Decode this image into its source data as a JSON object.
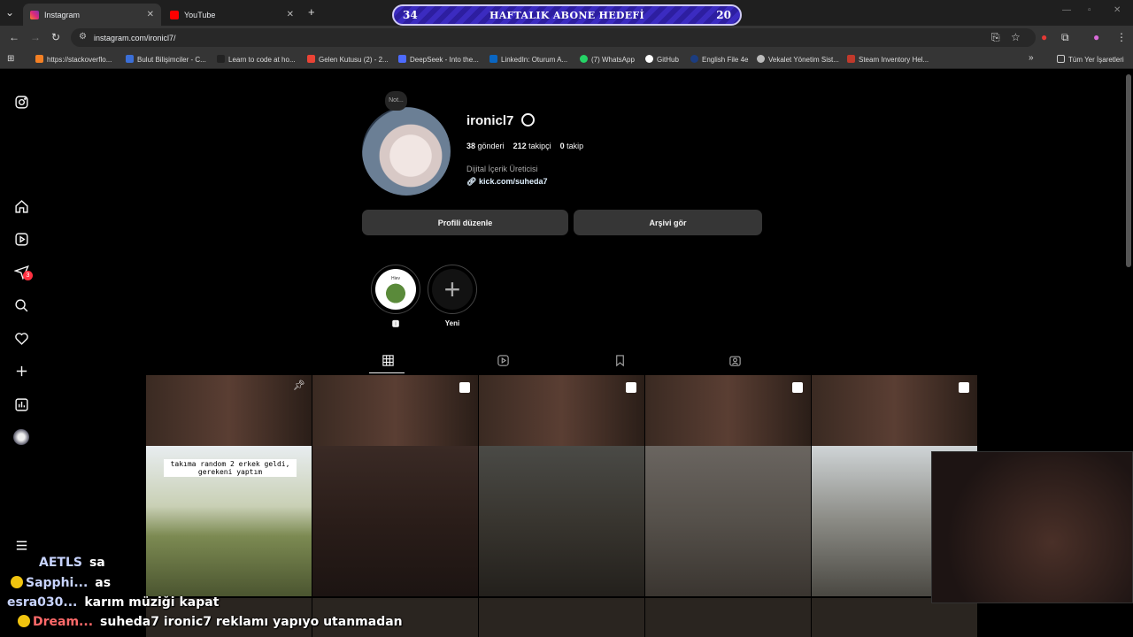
{
  "browser": {
    "tabs": [
      {
        "title": "Instagram",
        "active": true
      },
      {
        "title": "YouTube",
        "active": false
      }
    ],
    "url": "instagram.com/ironicl7/",
    "bookmarks": [
      "https://stackoverflo...",
      "Bulut Bilişimciler - C...",
      "Learn to code at ho...",
      "Gelen Kutusu (2) - 2...",
      "DeepSeek - Into the...",
      "LinkedIn: Oturum A...",
      "(7) WhatsApp",
      "GitHub",
      "English File 4e",
      "Vekalet Yönetim Sist...",
      "Steam Inventory Hel..."
    ],
    "all_bookmarks": "Tüm Yer İşaretleri"
  },
  "overlay": {
    "goal_left": "34",
    "goal_title": "HAFTALIK ABONE HEDEFİ",
    "goal_right": "20"
  },
  "profile": {
    "note": "Not...",
    "username": "ironicl7",
    "posts_count": "38",
    "posts_label": "gönderi",
    "followers_count": "212",
    "followers_label": "takipçi",
    "following_count": "0",
    "following_label": "takip",
    "category": "Dijital İçerik Üreticisi",
    "link": "kick.com/suheda7",
    "edit_button": "Profili düzenle",
    "archive_button": "Arşivi gör"
  },
  "highlights": [
    {
      "label": "🅸",
      "thumb_text": "Hiev"
    },
    {
      "label": "Yeni"
    }
  ],
  "posts": [
    {
      "overlay": "takıma random 2 erkek geldi, gerekeni yaptım",
      "pinned": true
    },
    {
      "overlay": "",
      "reel": true
    },
    {
      "overlay": "",
      "reel": true
    },
    {
      "overlay": "",
      "reel": true
    },
    {
      "overlay": "",
      "reel": true
    }
  ],
  "chat": [
    {
      "name": "AETLS",
      "message": "sa"
    },
    {
      "name": "Sapphi...",
      "message": "as"
    },
    {
      "name": "esra030...",
      "message": "karım müziği kapat"
    },
    {
      "name": "Dream...",
      "message": "suheda7 ironic7 reklamı yapıyo utanmadan"
    }
  ],
  "colors": {
    "accent_goal": "#3b2bc0",
    "badge": "#ff3040"
  },
  "notifications_badge": "3"
}
